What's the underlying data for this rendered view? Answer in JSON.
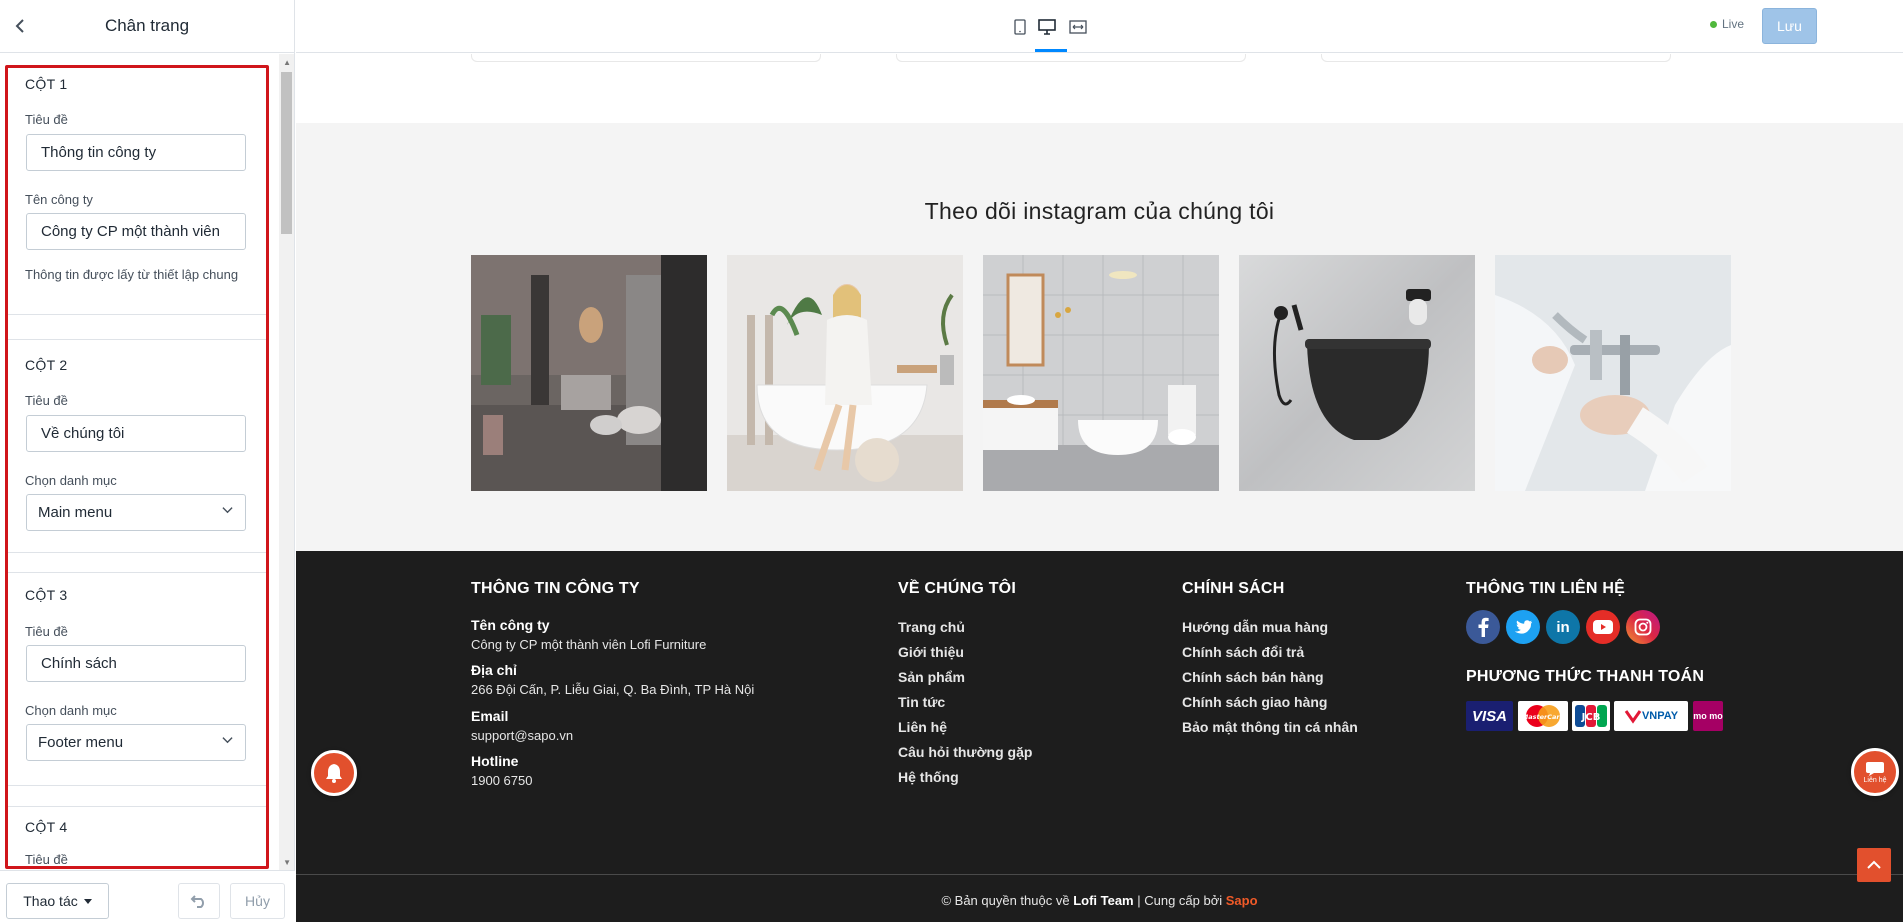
{
  "sidebar": {
    "title": "Chân trang",
    "columns": [
      {
        "heading": "CỘT 1",
        "title_label": "Tiêu đề",
        "title_value": "Thông tin công ty",
        "company_label": "Tên công ty",
        "company_value": "Công ty CP một thành viên",
        "note": "Thông tin được lấy từ thiết lập chung"
      },
      {
        "heading": "CỘT 2",
        "title_label": "Tiêu đề",
        "title_value": "Về chúng tôi",
        "menu_label": "Chọn danh mục",
        "menu_value": "Main menu"
      },
      {
        "heading": "CỘT 3",
        "title_label": "Tiêu đề",
        "title_value": "Chính sách",
        "menu_label": "Chọn danh mục",
        "menu_value": "Footer menu"
      },
      {
        "heading": "CỘT 4",
        "title_label": "Tiêu đề"
      }
    ],
    "footer": {
      "action_label": "Thao tác",
      "cancel_label": "Hủy"
    }
  },
  "topbar": {
    "live_label": "Live",
    "save_label": "Lưu"
  },
  "preview": {
    "instagram_title": "Theo dõi instagram của chúng tôi",
    "footer": {
      "col1": {
        "heading": "THÔNG TIN CÔNG TY",
        "company_label": "Tên công ty",
        "company_value": "Công ty CP một thành viên Lofi Furniture",
        "address_label": "Địa chỉ",
        "address_value": "266 Đội Cấn, P. Liễu Giai, Q. Ba Đình, TP Hà Nội",
        "email_label": "Email",
        "email_value": "support@sapo.vn",
        "hotline_label": "Hotline",
        "hotline_value": "1900 6750"
      },
      "col2": {
        "heading": "VỀ CHÚNG TÔI",
        "links": [
          "Trang chủ",
          "Giới thiệu",
          "Sản phẩm",
          "Tin tức",
          "Liên hệ",
          "Câu hỏi thường gặp",
          "Hệ thống"
        ]
      },
      "col3": {
        "heading": "CHÍNH SÁCH",
        "links": [
          "Hướng dẫn mua hàng",
          "Chính sách đổi trả",
          "Chính sách bán hàng",
          "Chính sách giao hàng",
          "Bảo mật thông tin cá nhân"
        ]
      },
      "col4": {
        "heading": "THÔNG TIN LIÊN HỆ",
        "payment_heading": "PHƯƠNG THỨC THANH TOÁN",
        "payments": [
          "VISA",
          "MasterCard",
          "JCB",
          "VNPAY",
          "mo mo"
        ]
      },
      "copyright_prefix": "© Bản quyền thuộc về ",
      "copyright_owner": "Lofi Team",
      "copyright_mid": " | Cung cấp bởi ",
      "copyright_provider": "Sapo"
    },
    "chat_label": "Liên hệ"
  },
  "colors": {
    "accent": "#0088ff",
    "highlight": "#d0161b",
    "brand_orange": "#e2502d",
    "footer_bg": "#1d1d1d"
  }
}
